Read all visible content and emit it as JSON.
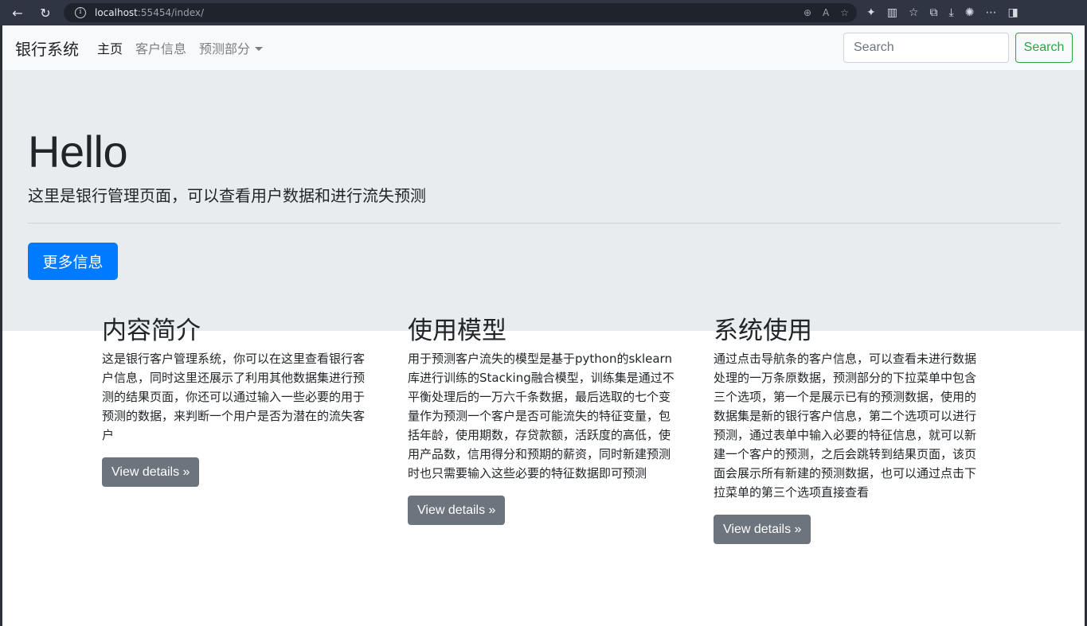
{
  "browser": {
    "url_host": "localhost",
    "url_rest": ":55454/index/"
  },
  "navbar": {
    "brand": "银行系统",
    "items": [
      {
        "label": "主页"
      },
      {
        "label": "客户信息"
      },
      {
        "label": "预测部分"
      }
    ],
    "search_placeholder": "Search",
    "search_button": "Search"
  },
  "jumbotron": {
    "title": "Hello",
    "lead": "这里是银行管理页面，可以查看用户数据和进行流失预测",
    "button": "更多信息"
  },
  "columns": [
    {
      "heading": "内容简介",
      "text": "这是银行客户管理系统，你可以在这里查看银行客户信息，同时这里还展示了利用其他数据集进行预测的结果页面，你还可以通过输入一些必要的用于预测的数据，来判断一个用户是否为潜在的流失客户",
      "button": "View details »"
    },
    {
      "heading": "使用模型",
      "text": "用于预测客户流失的模型是基于python的sklearn库进行训练的Stacking融合模型，训练集是通过不平衡处理后的一万六千条数据，最后选取的七个变量作为预测一个客户是否可能流失的特征变量，包括年龄，使用期数，存贷款额，活跃度的高低，使用产品数，信用得分和预期的薪资，同时新建预测时也只需要输入这些必要的特征数据即可预测",
      "button": "View details »"
    },
    {
      "heading": "系统使用",
      "text": "通过点击导航条的客户信息，可以查看未进行数据处理的一万条原数据，预测部分的下拉菜单中包含三个选项，第一个是展示已有的预测数据，使用的数据集是新的银行客户信息，第二个选项可以进行预测，通过表单中输入必要的特征信息，就可以新建一个客户的预测，之后会跳转到结果页面，该页面会展示所有新建的预测数据，也可以通过点击下拉菜单的第三个选项直接查看",
      "button": "View details »"
    }
  ]
}
